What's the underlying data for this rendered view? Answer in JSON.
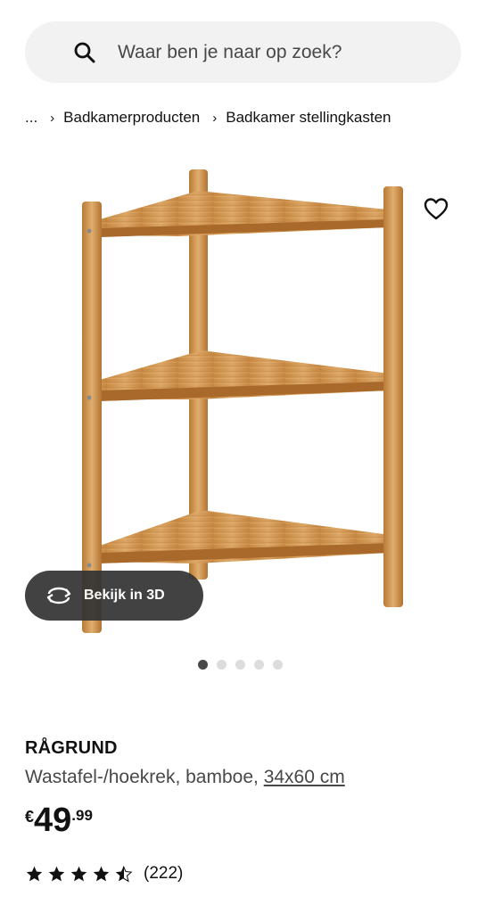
{
  "search": {
    "placeholder": "Waar ben je naar op zoek?",
    "icon": "search-icon"
  },
  "breadcrumb": {
    "ellipsis": "...",
    "items": [
      "Badkamerproducten",
      "Badkamer stellingkasten"
    ],
    "separator": "›"
  },
  "gallery": {
    "favorite_icon": "heart-icon",
    "view_3d_label": "Bekijk in 3D",
    "view_3d_icon": "rotate-3d-icon",
    "image_count": 5,
    "active_index": 0
  },
  "product": {
    "name": "RÅGRUND",
    "description": "Wastafel-/hoekrek, bamboe,",
    "size": "34x60 cm",
    "price_currency": "€",
    "price_integer": "49",
    "price_decimal": ".99",
    "rating_value": 4.5,
    "rating_max": 5,
    "review_count": "(222)"
  },
  "colors": {
    "bamboo": "#c98c45",
    "bamboo_light": "#e0ae6e",
    "bamboo_dark": "#a66d2e",
    "pill_bg": "#333333",
    "search_bg": "#f2f2f2",
    "dot_active": "#484848",
    "dot_inactive": "#dcdcdc"
  }
}
